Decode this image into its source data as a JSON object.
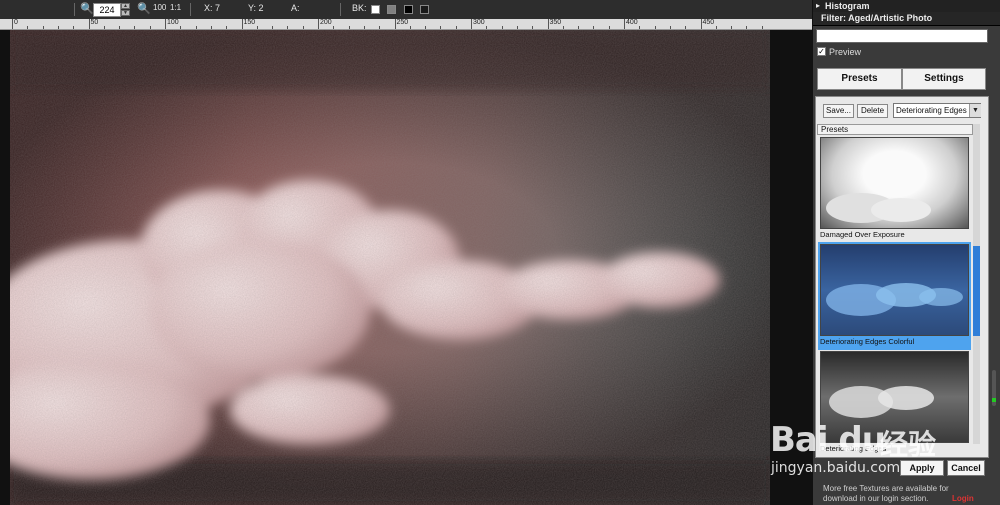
{
  "toolbar": {
    "zoom_value": "224",
    "fit_100": "100",
    "fit_1to1": "1:1",
    "x_readout": "X: 7",
    "y_readout": "Y: 2",
    "a_readout": "A:",
    "bk_label": "BK:",
    "bk_swatches": [
      "#ffffff",
      "#808080",
      "#000000",
      "#1a1a1a"
    ]
  },
  "ruler": {
    "labels": [
      "0",
      "50",
      "100",
      "150",
      "200",
      "250",
      "300",
      "350",
      "400",
      "450"
    ]
  },
  "panel": {
    "histogram_label": "Histogram",
    "filter_label": "Filter: Aged/Artistic Photo",
    "preview_label": "Preview",
    "preview_checked": true,
    "tabs": [
      {
        "label": "Presets"
      },
      {
        "label": "Settings"
      }
    ],
    "save_label": "Save...",
    "delete_label": "Delete",
    "preset_selected": "Deteriorating Edges C",
    "presets_header": "Presets",
    "thumbnails": [
      {
        "label": "Damaged Over Exposure"
      },
      {
        "label": "Deteriorating Edges Colorful"
      },
      {
        "label": "Deteriorating Edges"
      }
    ],
    "apply_label": "Apply",
    "cancel_label": "Cancel",
    "info_line1": "More free Textures are available for",
    "info_line2": "download in our login section.",
    "login_label": "Login",
    "accent_color": "#2f7ed8"
  },
  "watermark": {
    "logo": "Bai du",
    "cn": "经验",
    "url": "jingyan.baidu.com"
  }
}
